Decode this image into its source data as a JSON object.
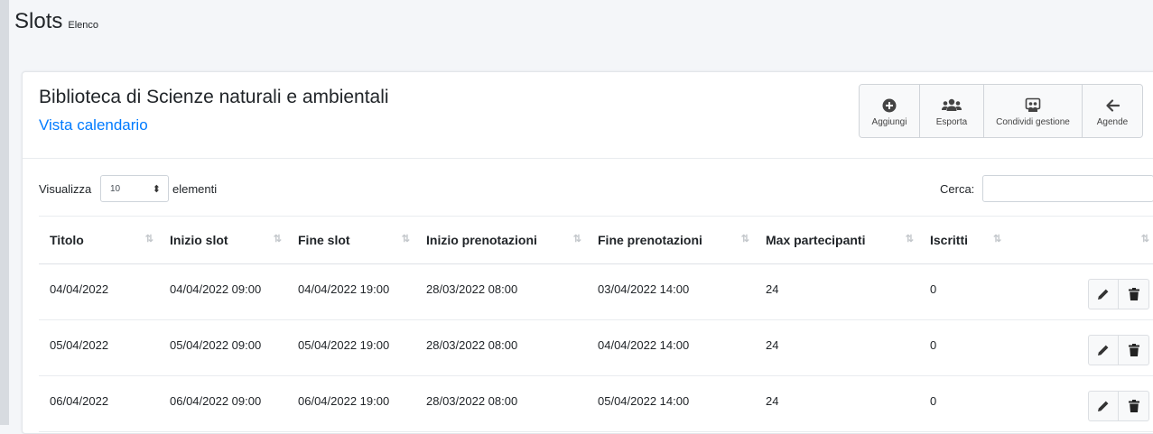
{
  "header": {
    "title": "Slots",
    "subtitle": "Elenco"
  },
  "card": {
    "library_title": "Biblioteca di Scienze naturali e ambientali",
    "calendar_link": "Vista calendario",
    "toolbar": [
      {
        "label": "Aggiungi",
        "icon": "plus-circle-icon"
      },
      {
        "label": "Esporta",
        "icon": "users-icon"
      },
      {
        "label": "Condividi gestione",
        "icon": "share-icon"
      },
      {
        "label": "Agende",
        "icon": "arrow-left-icon"
      }
    ]
  },
  "table_controls": {
    "show_label": "Visualizza",
    "page_length": "10",
    "elements_label": "elementi",
    "search_label": "Cerca:",
    "search_value": ""
  },
  "table": {
    "columns": [
      "Titolo",
      "Inizio slot",
      "Fine slot",
      "Inizio prenotazioni",
      "Fine prenotazioni",
      "Max partecipanti",
      "Iscritti",
      ""
    ],
    "rows": [
      [
        "04/04/2022",
        "04/04/2022 09:00",
        "04/04/2022 19:00",
        "28/03/2022 08:00",
        "03/04/2022 14:00",
        "24",
        "0"
      ],
      [
        "05/04/2022",
        "05/04/2022 09:00",
        "05/04/2022 19:00",
        "28/03/2022 08:00",
        "04/04/2022 14:00",
        "24",
        "0"
      ],
      [
        "06/04/2022",
        "06/04/2022 09:00",
        "06/04/2022 19:00",
        "28/03/2022 08:00",
        "05/04/2022 14:00",
        "24",
        "0"
      ]
    ]
  },
  "colors": {
    "link": "#007bff",
    "background": "#f4f6f9",
    "text": "#212529"
  }
}
